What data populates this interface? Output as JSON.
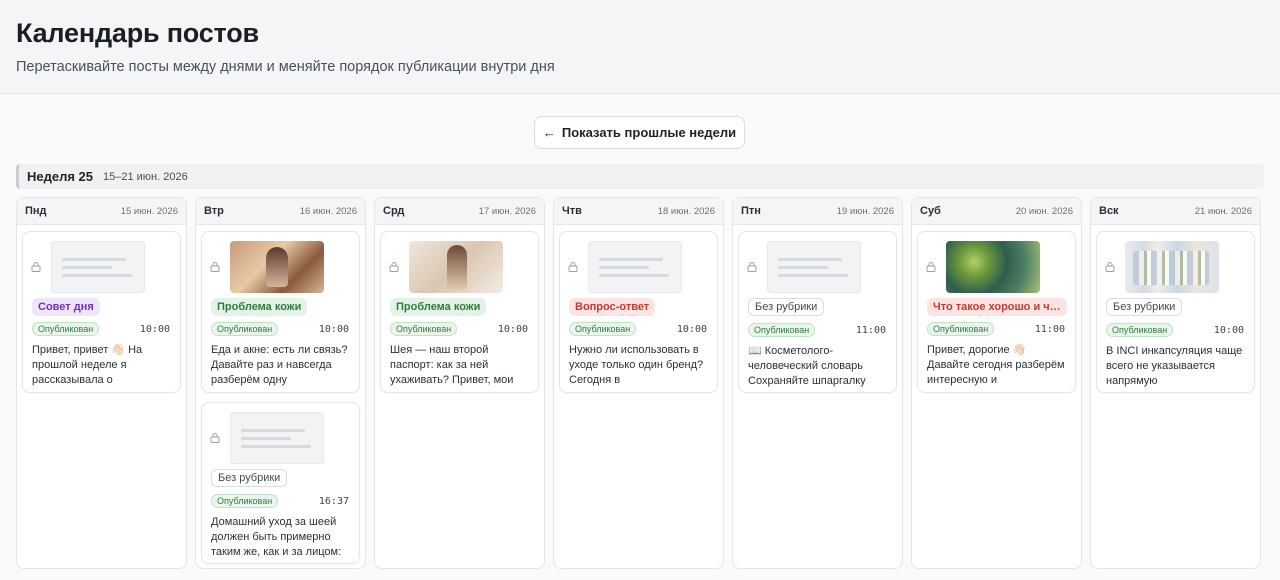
{
  "header": {
    "title": "Календарь постов",
    "subtitle": "Перетаскивайте посты между днями и меняйте порядок публикации внутри дня"
  },
  "controls": {
    "show_past_label": "Показать прошлые недели",
    "show_past_icon": "arrow-left-icon"
  },
  "week": {
    "title": "Неделя 25",
    "range": "15–21 июн. 2026"
  },
  "days": [
    {
      "name": "Пнд",
      "date": "15 июн. 2026",
      "posts": [
        {
          "thumb": "placeholder",
          "rubric": "Совет дня",
          "rubric_color": "purple",
          "status": "Опубликован",
          "time": "10:00",
          "excerpt": "Привет, привет 👋🏻 На прошлой неделе я рассказывала о"
        }
      ]
    },
    {
      "name": "Втр",
      "date": "16 июн. 2026",
      "posts": [
        {
          "thumb": "image",
          "rubric": "Проблема кожи",
          "rubric_color": "green",
          "status": "Опубликован",
          "time": "10:00",
          "excerpt": "Еда и акне: есть ли связь? Давайте раз и навсегда разберём одну"
        },
        {
          "thumb": "placeholder",
          "rubric": "Без рубрики",
          "rubric_color": "none",
          "status": "Опубликован",
          "time": "16:37",
          "excerpt": "Домашний уход за шеей должен быть примерно таким же, как и за лицом:"
        }
      ]
    },
    {
      "name": "Срд",
      "date": "17 июн. 2026",
      "posts": [
        {
          "thumb": "image",
          "rubric": "Проблема кожи",
          "rubric_color": "green",
          "status": "Опубликован",
          "time": "10:00",
          "excerpt": "Шея — наш второй паспорт: как за ней ухаживать? Привет, мои"
        }
      ]
    },
    {
      "name": "Чтв",
      "date": "18 июн. 2026",
      "posts": [
        {
          "thumb": "placeholder",
          "rubric": "Вопрос-ответ",
          "rubric_color": "red",
          "status": "Опубликован",
          "time": "10:00",
          "excerpt": "Нужно ли использовать в уходе только один бренд? Сегодня в"
        }
      ]
    },
    {
      "name": "Птн",
      "date": "19 июн. 2026",
      "posts": [
        {
          "thumb": "placeholder",
          "rubric": "Без рубрики",
          "rubric_color": "none",
          "status": "Опубликован",
          "time": "11:00",
          "excerpt": "📖 Косметолого-человеческий словарь Сохраняйте шпаргалку"
        }
      ]
    },
    {
      "name": "Суб",
      "date": "20 июн. 2026",
      "posts": [
        {
          "thumb": "image",
          "rubric": "Что такое хорошо и ч…",
          "rubric_color": "red",
          "status": "Опубликован",
          "time": "11:00",
          "excerpt": "Привет, дорогие 👋🏻 Давайте сегодня разберём интересную и"
        }
      ]
    },
    {
      "name": "Вск",
      "date": "21 июн. 2026",
      "posts": [
        {
          "thumb": "image",
          "rubric": "Без рубрики",
          "rubric_color": "none",
          "status": "Опубликован",
          "time": "10:00",
          "excerpt": "В INCI инкапсуляция чаще всего не указывается напрямую"
        }
      ]
    }
  ]
}
